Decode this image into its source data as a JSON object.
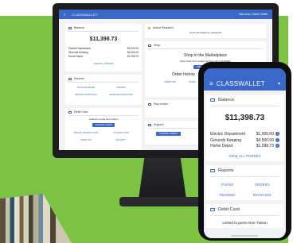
{
  "desktop": {
    "header": {
      "logo": "CLASSWALLET",
      "welcome": "Welcome, Robert Smith"
    },
    "balance": {
      "title": "Balance",
      "amount": "$11,398.73",
      "rows": [
        {
          "name": "Electric Department",
          "value": "$1,000.00"
        },
        {
          "name": "Grounds Keeping",
          "value": "$4,500.00"
        },
        {
          "name": "Home Depot",
          "value": "$1,098.73"
        }
      ],
      "view_all": "VIEW ALL PURSES"
    },
    "action_required": {
      "title": "Action Required",
      "message": "You're all caught up. Great job!"
    },
    "shop": {
      "title": "Shop",
      "marketplace_title": "Shop in the Marketplace",
      "marketplace_text": "Shop online from vendors and pay with ClassWallet",
      "start_button": "START SHOPPING",
      "order_history": "Order history",
      "submitted": "SUBMITTED",
      "saved": "SAVED"
    },
    "reports": {
      "title": "Reports",
      "items": [
        "TRANS RECEIVED",
        "ORDERS",
        "PENDING APPROVALS",
        "RECEIVED DONATIONS"
      ]
    },
    "debit_card": {
      "title": "Debit Card",
      "note": "Linked to purse Non-Tuition",
      "change_cards": "CHANGE CARDS",
      "links": [
        "RECENT TRANSACTIONS",
        "ACTIVATE CARD",
        "RESET PIN",
        "SECURITY"
      ]
    },
    "pay_vendor": {
      "title": "Pay vendor",
      "button": "PAY VENDOR"
    },
    "support": {
      "title": "Support",
      "button": "TRAINING VIDEOS"
    }
  },
  "phone": {
    "header": {
      "logo": "CLASSWALLET"
    },
    "balance": {
      "title": "Balance",
      "amount": "$11,398.73",
      "rows": [
        {
          "name": "Electric Department",
          "value": "$1,000.00"
        },
        {
          "name": "Grounds Keeping",
          "value": "$4,500.00"
        },
        {
          "name": "Home Depot",
          "value": "$1,098.73"
        }
      ],
      "view_all": "VIEW ALL PURSES"
    },
    "reports": {
      "title": "Reports",
      "items": [
        "PURSE",
        "ORDERS",
        "PENDING",
        "RECEIVED"
      ]
    },
    "debit_card": {
      "title": "Debit Card",
      "note": "Linked to purse Non-Tuition"
    }
  },
  "colors": {
    "brand_blue": "#3a67c8",
    "background_green": "#7cc243",
    "info_blue": "#3a67c8",
    "alert_orange": "#f39c2c"
  }
}
